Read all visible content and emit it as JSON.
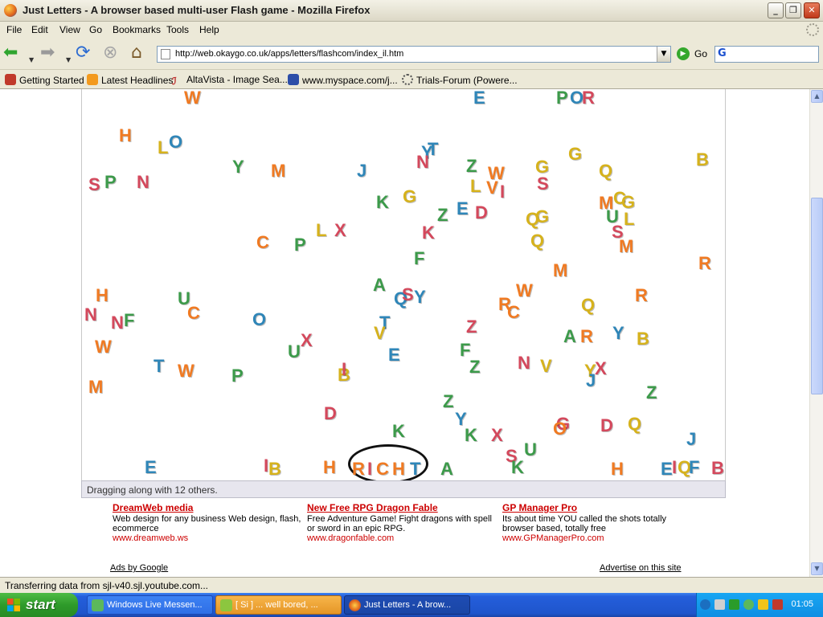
{
  "window": {
    "title": "Just Letters - A browser based multi-user Flash game - Mozilla Firefox"
  },
  "menu": [
    "File",
    "Edit",
    "View",
    "Go",
    "Bookmarks",
    "Tools",
    "Help"
  ],
  "toolbar": {
    "url": "http://web.okaygo.co.uk/apps/letters/flashcom/index_il.htm",
    "go_label": "Go"
  },
  "bookmarks": [
    "Getting Started",
    "Latest Headlines",
    "AltaVista - Image Sea...",
    "www.myspace.com/j...",
    "Trials-Forum (Powere..."
  ],
  "game": {
    "status": "Dragging along with 12 others.",
    "colors": {
      "red": "#e0403a",
      "orange": "#f07a22",
      "green": "#3c9a4a",
      "teal": "#2f86b8",
      "yellow": "#d6b21c",
      "pink": "#d4485c"
    },
    "letters": [
      [
        "W",
        "orange",
        127,
        0
      ],
      [
        "E",
        "teal",
        487,
        0
      ],
      [
        "P",
        "green",
        590,
        0
      ],
      [
        "O",
        "teal",
        607,
        0
      ],
      [
        "R",
        "pink",
        622,
        0
      ],
      [
        "H",
        "orange",
        46,
        47
      ],
      [
        "L",
        "yellow",
        94,
        62
      ],
      [
        "O",
        "teal",
        108,
        55
      ],
      [
        "Y",
        "teal",
        422,
        68
      ],
      [
        "T",
        "teal",
        430,
        64
      ],
      [
        "N",
        "pink",
        416,
        80
      ],
      [
        "G",
        "yellow",
        605,
        70
      ],
      [
        "B",
        "yellow",
        764,
        77
      ],
      [
        "S",
        "pink",
        8,
        108
      ],
      [
        "P",
        "green",
        28,
        105
      ],
      [
        "N",
        "pink",
        68,
        105
      ],
      [
        "Y",
        "green",
        187,
        86
      ],
      [
        "M",
        "orange",
        235,
        91
      ],
      [
        "J",
        "teal",
        342,
        91
      ],
      [
        "Z",
        "green",
        478,
        85
      ],
      [
        "W",
        "orange",
        505,
        94
      ],
      [
        "L",
        "yellow",
        483,
        110
      ],
      [
        "V",
        "orange",
        503,
        112
      ],
      [
        "I",
        "pink",
        520,
        117
      ],
      [
        "G",
        "yellow",
        564,
        86
      ],
      [
        "S",
        "pink",
        566,
        107
      ],
      [
        "Q",
        "yellow",
        643,
        91
      ],
      [
        "K",
        "green",
        366,
        130
      ],
      [
        "G",
        "yellow",
        399,
        123
      ],
      [
        "Z",
        "green",
        442,
        146
      ],
      [
        "E",
        "teal",
        466,
        138
      ],
      [
        "D",
        "pink",
        489,
        143
      ],
      [
        "M",
        "orange",
        643,
        131
      ],
      [
        "C",
        "yellow",
        661,
        125
      ],
      [
        "G",
        "yellow",
        671,
        130
      ],
      [
        "U",
        "green",
        652,
        148
      ],
      [
        "L",
        "yellow",
        674,
        151
      ],
      [
        "Q",
        "yellow",
        552,
        151
      ],
      [
        "G",
        "yellow",
        564,
        148
      ],
      [
        "S",
        "pink",
        659,
        167
      ],
      [
        "C",
        "orange",
        217,
        180
      ],
      [
        "P",
        "green",
        264,
        183
      ],
      [
        "L",
        "yellow",
        291,
        165
      ],
      [
        "X",
        "pink",
        314,
        165
      ],
      [
        "K",
        "pink",
        423,
        168
      ],
      [
        "F",
        "green",
        413,
        200
      ],
      [
        "Q",
        "yellow",
        558,
        178
      ],
      [
        "M",
        "orange",
        668,
        185
      ],
      [
        "M",
        "orange",
        586,
        215
      ],
      [
        "R",
        "orange",
        767,
        206
      ],
      [
        "A",
        "green",
        362,
        233
      ],
      [
        "Q",
        "teal",
        388,
        250
      ],
      [
        "S",
        "pink",
        398,
        245
      ],
      [
        "Y",
        "teal",
        413,
        248
      ],
      [
        "H",
        "orange",
        17,
        246
      ],
      [
        "U",
        "green",
        119,
        250
      ],
      [
        "C",
        "orange",
        131,
        268
      ],
      [
        "N",
        "pink",
        3,
        270
      ],
      [
        "N",
        "pink",
        36,
        280
      ],
      [
        "F",
        "green",
        52,
        277
      ],
      [
        "W",
        "orange",
        540,
        240
      ],
      [
        "R",
        "orange",
        518,
        257
      ],
      [
        "C",
        "orange",
        529,
        267
      ],
      [
        "R",
        "orange",
        688,
        246
      ],
      [
        "Q",
        "yellow",
        621,
        258
      ],
      [
        "O",
        "teal",
        212,
        276
      ],
      [
        "T",
        "teal",
        370,
        280
      ],
      [
        "V",
        "yellow",
        363,
        293
      ],
      [
        "Z",
        "pink",
        478,
        285
      ],
      [
        "A",
        "green",
        599,
        297
      ],
      [
        "R",
        "orange",
        620,
        297
      ],
      [
        "Y",
        "teal",
        660,
        293
      ],
      [
        "B",
        "yellow",
        690,
        300
      ],
      [
        "W",
        "orange",
        16,
        310
      ],
      [
        "X",
        "pink",
        272,
        302
      ],
      [
        "U",
        "green",
        256,
        316
      ],
      [
        "E",
        "teal",
        381,
        320
      ],
      [
        "F",
        "green",
        470,
        314
      ],
      [
        "Z",
        "green",
        482,
        335
      ],
      [
        "N",
        "pink",
        542,
        330
      ],
      [
        "V",
        "yellow",
        570,
        334
      ],
      [
        "Y",
        "yellow",
        625,
        340
      ],
      [
        "X",
        "pink",
        638,
        337
      ],
      [
        "J",
        "teal",
        627,
        352
      ],
      [
        "T",
        "teal",
        89,
        334
      ],
      [
        "W",
        "orange",
        119,
        340
      ],
      [
        "P",
        "green",
        186,
        346
      ],
      [
        "B",
        "yellow",
        318,
        345
      ],
      [
        "I",
        "pink",
        323,
        338
      ],
      [
        "Z",
        "green",
        702,
        367
      ],
      [
        "M",
        "orange",
        8,
        360
      ],
      [
        "Z",
        "green",
        449,
        378
      ],
      [
        "Y",
        "teal",
        464,
        400
      ],
      [
        "K",
        "green",
        476,
        420
      ],
      [
        "X",
        "pink",
        509,
        420
      ],
      [
        "D",
        "pink",
        301,
        393
      ],
      [
        "K",
        "green",
        386,
        415
      ],
      [
        "G",
        "pink",
        590,
        406
      ],
      [
        "O",
        "orange",
        586,
        412
      ],
      [
        "D",
        "pink",
        645,
        408
      ],
      [
        "Q",
        "yellow",
        679,
        406
      ],
      [
        "J",
        "teal",
        752,
        425
      ],
      [
        "U",
        "green",
        550,
        438
      ],
      [
        "S",
        "pink",
        527,
        446
      ],
      [
        "K",
        "green",
        534,
        460
      ],
      [
        "E",
        "teal",
        78,
        460
      ],
      [
        "I",
        "pink",
        226,
        458
      ],
      [
        "B",
        "yellow",
        232,
        462
      ],
      [
        "H",
        "orange",
        300,
        460
      ],
      [
        "A",
        "green",
        446,
        462
      ],
      [
        "H",
        "orange",
        658,
        462
      ],
      [
        "E",
        "teal",
        720,
        462
      ],
      [
        "I",
        "pink",
        734,
        460
      ],
      [
        "Q",
        "yellow",
        741,
        460
      ],
      [
        "F",
        "teal",
        755,
        460
      ],
      [
        "B",
        "pink",
        783,
        461
      ],
      [
        "R",
        "orange",
        336,
        462
      ],
      [
        "I",
        "pink",
        355,
        462
      ],
      [
        "C",
        "orange",
        366,
        462
      ],
      [
        "H",
        "orange",
        386,
        462
      ],
      [
        "T",
        "teal",
        408,
        462
      ]
    ]
  },
  "ads": [
    {
      "title": "DreamWeb media",
      "desc": "Web design for any business Web design, flash, ecommerce",
      "url": "www.dreamweb.ws"
    },
    {
      "title": "New Free RPG Dragon Fable",
      "desc": "Free Adventure Game! Fight dragons with spell or sword in an epic RPG.",
      "url": "www.dragonfable.com"
    },
    {
      "title": "GP Manager Pro",
      "desc": "Its about time YOU called the shots totally browser based, totally free",
      "url": "www.GPManagerPro.com"
    }
  ],
  "ads_by_google": "Ads by Google",
  "advertise": "Advertise on this site",
  "statusbar": {
    "text": "Transferring data from sjl-v40.sjl.youtube.com..."
  },
  "taskbar": {
    "start": "start",
    "tasks": [
      "Windows Live Messen...",
      "[ Si ] ... well bored, ...",
      "Just Letters - A brow..."
    ],
    "clock": "01:05"
  }
}
